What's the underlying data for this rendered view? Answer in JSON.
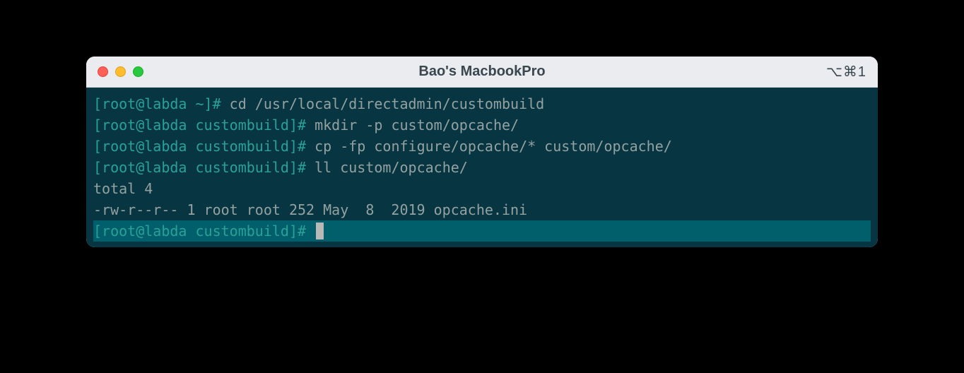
{
  "titlebar": {
    "title": "Bao's MacbookPro",
    "shortcut": "⌥⌘1"
  },
  "lines": [
    {
      "prompt": "[root@labda ~]# ",
      "cmd": "cd /usr/local/directadmin/custombuild"
    },
    {
      "prompt": "[root@labda custombuild]# ",
      "cmd": "mkdir -p custom/opcache/"
    },
    {
      "prompt": "[root@labda custombuild]# ",
      "cmd": "cp -fp configure/opcache/* custom/opcache/"
    },
    {
      "prompt": "[root@labda custombuild]# ",
      "cmd": "ll custom/opcache/"
    }
  ],
  "output": [
    "total 4",
    "-rw-r--r-- 1 root root 252 May  8  2019 opcache.ini"
  ],
  "active_prompt": "[root@labda custombuild]# "
}
